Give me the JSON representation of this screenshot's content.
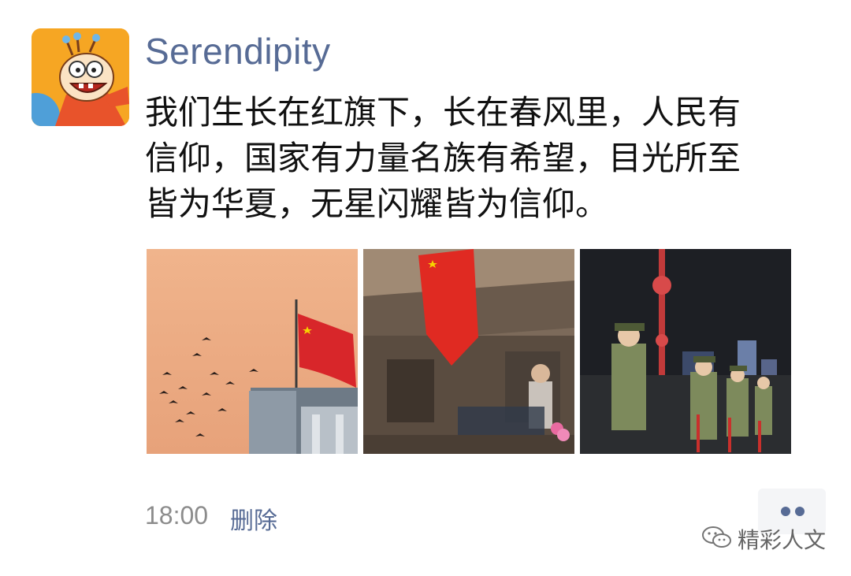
{
  "post": {
    "username": "Serendipity",
    "text": "我们生长在红旗下，长在春风里，人民有\n信仰，国家有力量名族有希望，目光所至\n皆为华夏，无星闪耀皆为信仰。",
    "time": "18:00",
    "delete_label": "删除"
  },
  "photos": [
    {
      "name": "flag-birds-sunset-photo"
    },
    {
      "name": "flag-old-street-photo"
    },
    {
      "name": "honor-guard-night-photo"
    }
  ],
  "watermark": {
    "text": "精彩人文"
  },
  "colors": {
    "link": "#576b95",
    "text": "#111111",
    "time": "#8c8c8c"
  }
}
